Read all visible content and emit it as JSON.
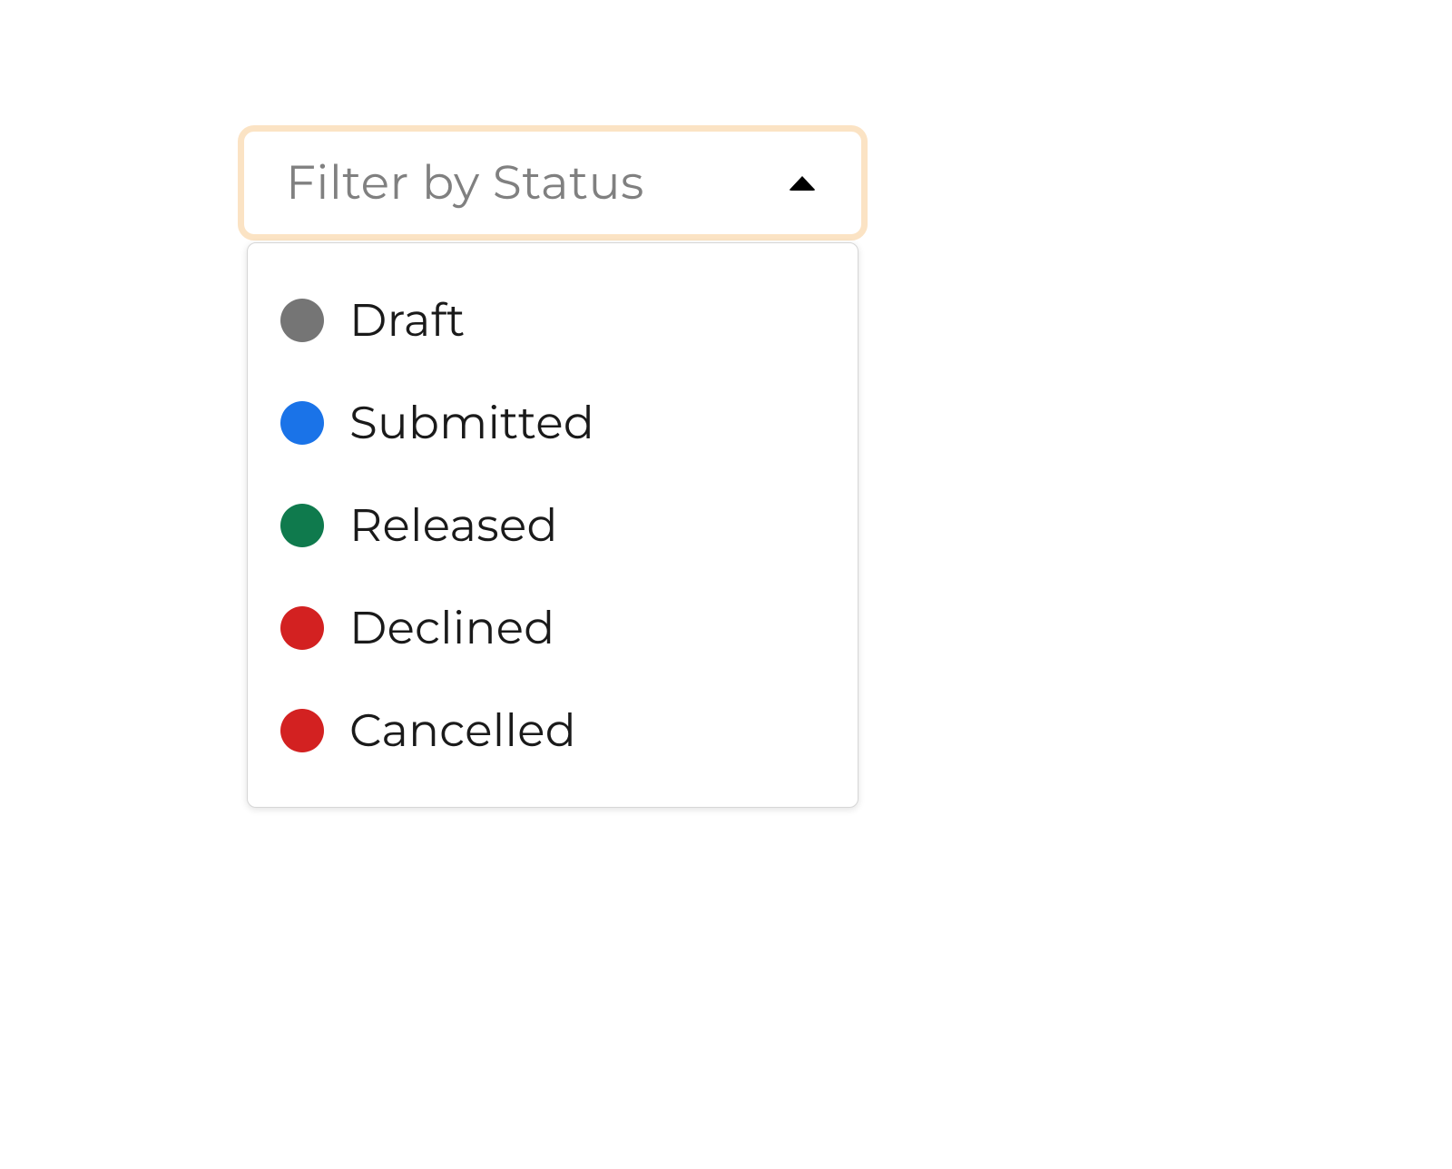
{
  "dropdown": {
    "label": "Filter by Status",
    "options": [
      {
        "label": "Draft",
        "color": "#757575"
      },
      {
        "label": "Submitted",
        "color": "#1a73e8"
      },
      {
        "label": "Released",
        "color": "#0f7a4d"
      },
      {
        "label": "Declined",
        "color": "#d32121"
      },
      {
        "label": "Cancelled",
        "color": "#d32121"
      }
    ]
  }
}
